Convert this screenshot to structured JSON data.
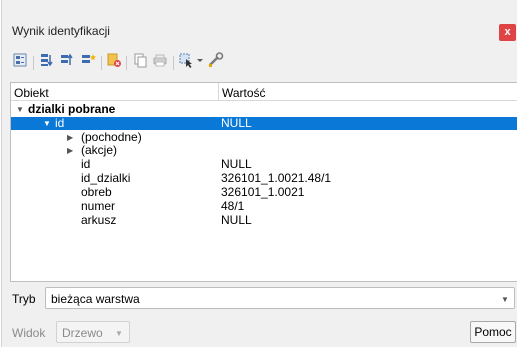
{
  "window": {
    "title": "Wynik identyfikacji",
    "close_glyph": "x"
  },
  "toolbar": {
    "icons": [
      "expand-new-features-icon",
      "expand-all-icon",
      "collapse-all-icon",
      "expand-icon",
      "clear-results-icon",
      "copy-feature-icon",
      "print-icon",
      "select-features-icon",
      "dropdown-arrow-icon",
      "settings-icon"
    ]
  },
  "table": {
    "headers": {
      "object": "Obiekt",
      "value": "Wartość"
    },
    "layer": "dzialki pobrane",
    "selected": {
      "key": "id",
      "value": "NULL"
    },
    "groups": [
      "(pochodne)",
      "(akcje)"
    ],
    "attributes": [
      {
        "key": "id",
        "value": "NULL"
      },
      {
        "key": "id_dzialki",
        "value": "326101_1.0021.48/1"
      },
      {
        "key": "obreb",
        "value": "326101_1.0021"
      },
      {
        "key": "numer",
        "value": "48/1"
      },
      {
        "key": "arkusz",
        "value": "NULL"
      }
    ]
  },
  "footer": {
    "mode_label": "Tryb",
    "mode_value": "bieżąca warstwa",
    "view_label": "Widok",
    "view_value": "Drzewo",
    "help_button": "Pomoc"
  },
  "colors": {
    "selection": "#0a78d7",
    "close": "#e04343"
  }
}
